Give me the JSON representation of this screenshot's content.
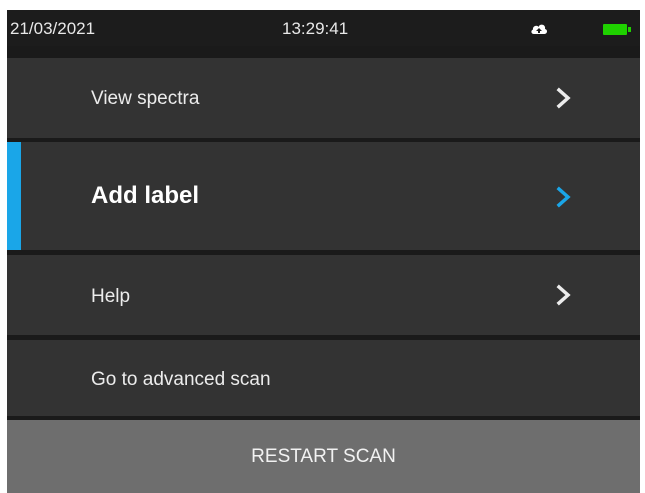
{
  "status_bar": {
    "date": "21/03/2021",
    "time": "13:29:41",
    "cloud_icon": "cloud-upload-icon",
    "battery_icon": "battery-full-icon",
    "battery_color": "#1fd100"
  },
  "menu": {
    "items": [
      {
        "label": "View spectra",
        "chevron": true
      },
      {
        "label": "Add label",
        "chevron": true,
        "selected": true
      },
      {
        "label": "Help",
        "chevron": true
      },
      {
        "label": "Go to advanced scan",
        "chevron": false
      }
    ],
    "accent_color": "#1aa6e8",
    "chevron_icon": "chevron-right-icon"
  },
  "footer": {
    "restart_label": "RESTART SCAN"
  }
}
